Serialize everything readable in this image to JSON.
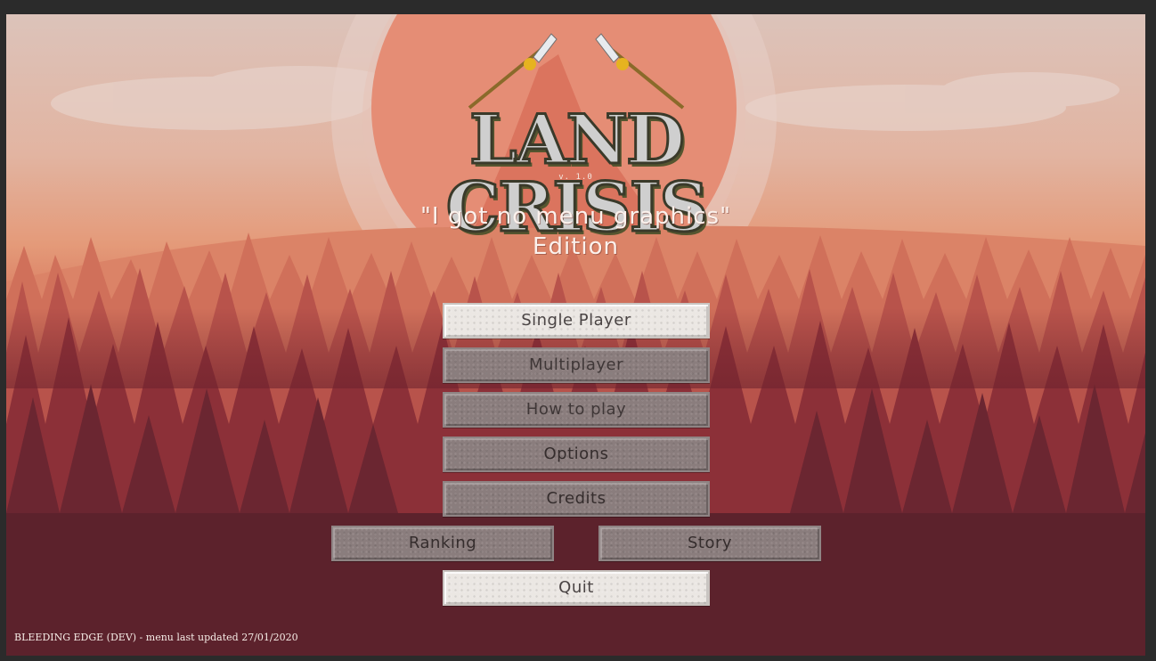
{
  "logo": {
    "title": "LAND CRISIS"
  },
  "version": "v. 1.0",
  "subtitle": {
    "line1": "\"I got no menu graphics\"",
    "line2": "Edition"
  },
  "menu": {
    "single_player": "Single Player",
    "multiplayer": "Multiplayer",
    "how_to_play": "How to play",
    "options": "Options",
    "credits": "Credits",
    "ranking": "Ranking",
    "story": "Story",
    "quit": "Quit"
  },
  "footer": "BLEEDING EDGE (DEV) - menu last updated 27/01/2020",
  "colors": {
    "sky": "#dcc3ba",
    "sun": "#e58d75",
    "forest_far": "#d06a55",
    "forest_near": "#6e2832",
    "button_light": "#ebe7e3",
    "button_dark": "#8a7d7d"
  }
}
